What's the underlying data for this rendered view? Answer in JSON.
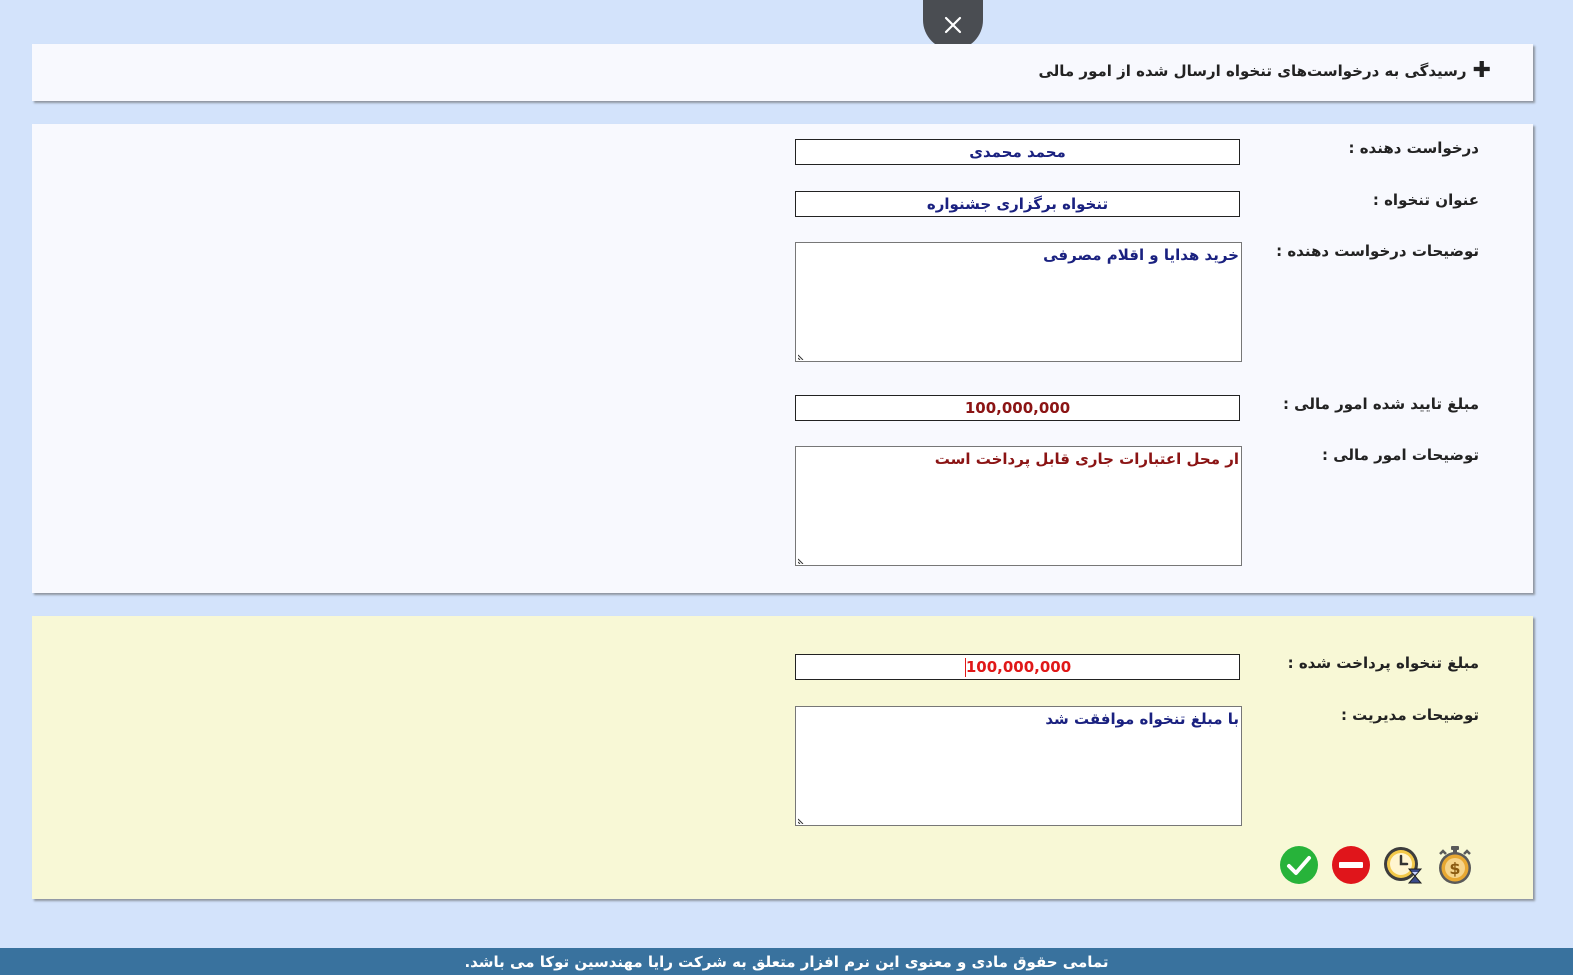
{
  "header": {
    "title": "رسیدگی به درخواست‌های تنخواه ارسال شده از امور مالی",
    "plus_symbol": "✚"
  },
  "request": {
    "requester_label": "درخواست دهنده :",
    "requester_value": "محمد محمدی",
    "title_label": "عنوان تنخواه :",
    "title_value": "تنخواه برگزاری جشنواره",
    "requester_desc_label": "توضیحات درخواست دهنده :",
    "requester_desc_value": "خرید هدایا و اقلام مصرفی",
    "approved_amount_label": "مبلغ تایید شده امور مالی :",
    "approved_amount_value": "100,000,000",
    "finance_desc_label": "توضیحات امور مالی :",
    "finance_desc_value": "ار محل اعتبارات جاری قابل پرداخت است"
  },
  "management": {
    "paid_amount_label": "مبلغ تنخواه پرداخت شده :",
    "paid_amount_value": "100,000,000",
    "mgmt_desc_label": "توضیحات مدیریت :",
    "mgmt_desc_value": "با مبلغ تنخواه موافقت شد"
  },
  "actions": [
    "money-timer-icon",
    "clock-hourglass-icon",
    "reject-icon",
    "approve-icon"
  ],
  "colors": {
    "page_bg": "#d3e3fb",
    "card_bg": "#f8f9fe",
    "management_bg": "#f8f8d6",
    "footer_bg": "#39729e",
    "value_blue": "#1a2180",
    "value_maroon": "#8b1414",
    "value_red": "#e01818"
  },
  "footer": {
    "copyright": "تمامی حقوق مادی و معنوی این نرم افزار متعلق به شرکت رایا مهندسین توکا می باشد."
  }
}
